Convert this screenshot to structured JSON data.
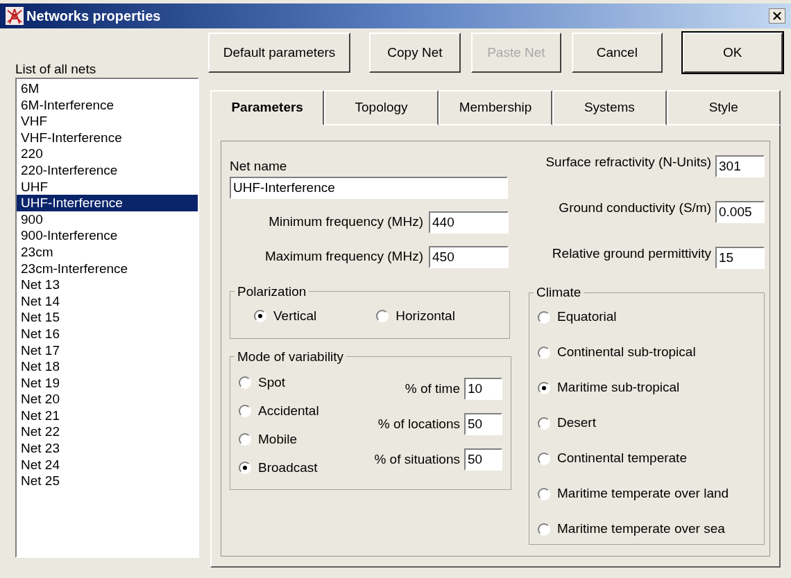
{
  "window": {
    "title": "Networks properties"
  },
  "nets_list": {
    "label": "List of all nets",
    "items": [
      {
        "name": "6M",
        "selected": false
      },
      {
        "name": "6M-Interference",
        "selected": false
      },
      {
        "name": "VHF",
        "selected": false
      },
      {
        "name": "VHF-Interference",
        "selected": false
      },
      {
        "name": "220",
        "selected": false
      },
      {
        "name": "220-Interference",
        "selected": false
      },
      {
        "name": "UHF",
        "selected": false
      },
      {
        "name": "UHF-Interference",
        "selected": true
      },
      {
        "name": "900",
        "selected": false
      },
      {
        "name": "900-Interference",
        "selected": false
      },
      {
        "name": "23cm",
        "selected": false
      },
      {
        "name": "23cm-Interference",
        "selected": false
      },
      {
        "name": "Net 13",
        "selected": false
      },
      {
        "name": "Net 14",
        "selected": false
      },
      {
        "name": "Net 15",
        "selected": false
      },
      {
        "name": "Net 16",
        "selected": false
      },
      {
        "name": "Net 17",
        "selected": false
      },
      {
        "name": "Net 18",
        "selected": false
      },
      {
        "name": "Net 19",
        "selected": false
      },
      {
        "name": "Net 20",
        "selected": false
      },
      {
        "name": "Net 21",
        "selected": false
      },
      {
        "name": "Net 22",
        "selected": false
      },
      {
        "name": "Net 23",
        "selected": false
      },
      {
        "name": "Net 24",
        "selected": false
      },
      {
        "name": "Net 25",
        "selected": false
      }
    ]
  },
  "buttons": [
    {
      "label": "Default parameters",
      "disabled": false,
      "default": false
    },
    {
      "label": "Copy Net",
      "disabled": false,
      "default": false
    },
    {
      "label": "Paste Net",
      "disabled": true,
      "default": false
    },
    {
      "label": "Cancel",
      "disabled": false,
      "default": false
    },
    {
      "label": "OK",
      "disabled": false,
      "default": true
    }
  ],
  "tabs": [
    {
      "label": "Parameters",
      "selected": true
    },
    {
      "label": "Topology",
      "selected": false
    },
    {
      "label": "Membership",
      "selected": false
    },
    {
      "label": "Systems",
      "selected": false
    },
    {
      "label": "Style",
      "selected": false
    }
  ],
  "net_name": {
    "label": "Net name",
    "value": "UHF-Interference"
  },
  "frequencies": [
    {
      "label": "Minimum frequency (MHz)",
      "value": "440"
    },
    {
      "label": "Maximum frequency (MHz)",
      "value": "450"
    }
  ],
  "polarization": {
    "title": "Polarization",
    "options": [
      {
        "label": "Vertical",
        "selected": true
      },
      {
        "label": "Horizontal",
        "selected": false
      }
    ]
  },
  "variability": {
    "title": "Mode of variability",
    "options": [
      {
        "label": "Spot",
        "selected": false
      },
      {
        "label": "Accidental",
        "selected": false
      },
      {
        "label": "Mobile",
        "selected": false
      },
      {
        "label": "Broadcast",
        "selected": true
      }
    ],
    "fields": [
      {
        "label": "% of time",
        "value": "10"
      },
      {
        "label": "% of locations",
        "value": "50"
      },
      {
        "label": "% of situations",
        "value": "50"
      }
    ]
  },
  "ground_fields": [
    {
      "label": "Surface refractivity (N-Units)",
      "value": "301"
    },
    {
      "label": "Ground conductivity (S/m)",
      "value": "0.005"
    },
    {
      "label": "Relative ground permittivity",
      "value": "15"
    }
  ],
  "climate": {
    "title": "Climate",
    "options": [
      {
        "label": "Equatorial",
        "selected": false
      },
      {
        "label": "Continental sub-tropical",
        "selected": false
      },
      {
        "label": "Maritime sub-tropical",
        "selected": true
      },
      {
        "label": "Desert",
        "selected": false
      },
      {
        "label": "Continental temperate",
        "selected": false
      },
      {
        "label": "Maritime temperate over land",
        "selected": false
      },
      {
        "label": "Maritime temperate over sea",
        "selected": false
      }
    ]
  }
}
